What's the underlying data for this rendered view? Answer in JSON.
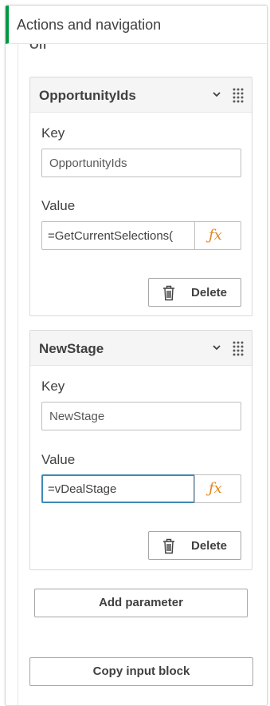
{
  "panel": {
    "title": "Actions and navigation",
    "accent_color": "#009845"
  },
  "previous_value": "Off",
  "parameters": [
    {
      "name": "OpportunityIds",
      "key_label": "Key",
      "key_value": "OpportunityIds",
      "value_label": "Value",
      "value": "=GetCurrentSelections(",
      "fx_icon": "function-fx-icon",
      "delete_label": "Delete"
    },
    {
      "name": "NewStage",
      "key_label": "Key",
      "key_value": "NewStage",
      "value_label": "Value",
      "value": "=vDealStage",
      "fx_icon": "function-fx-icon",
      "delete_label": "Delete"
    }
  ],
  "fx_glyph": "ƒx",
  "add_parameter_label": "Add parameter",
  "copy_input_block_label": "Copy input block",
  "colors": {
    "fx": "#e3861c",
    "focus": "#3f8ab3"
  }
}
